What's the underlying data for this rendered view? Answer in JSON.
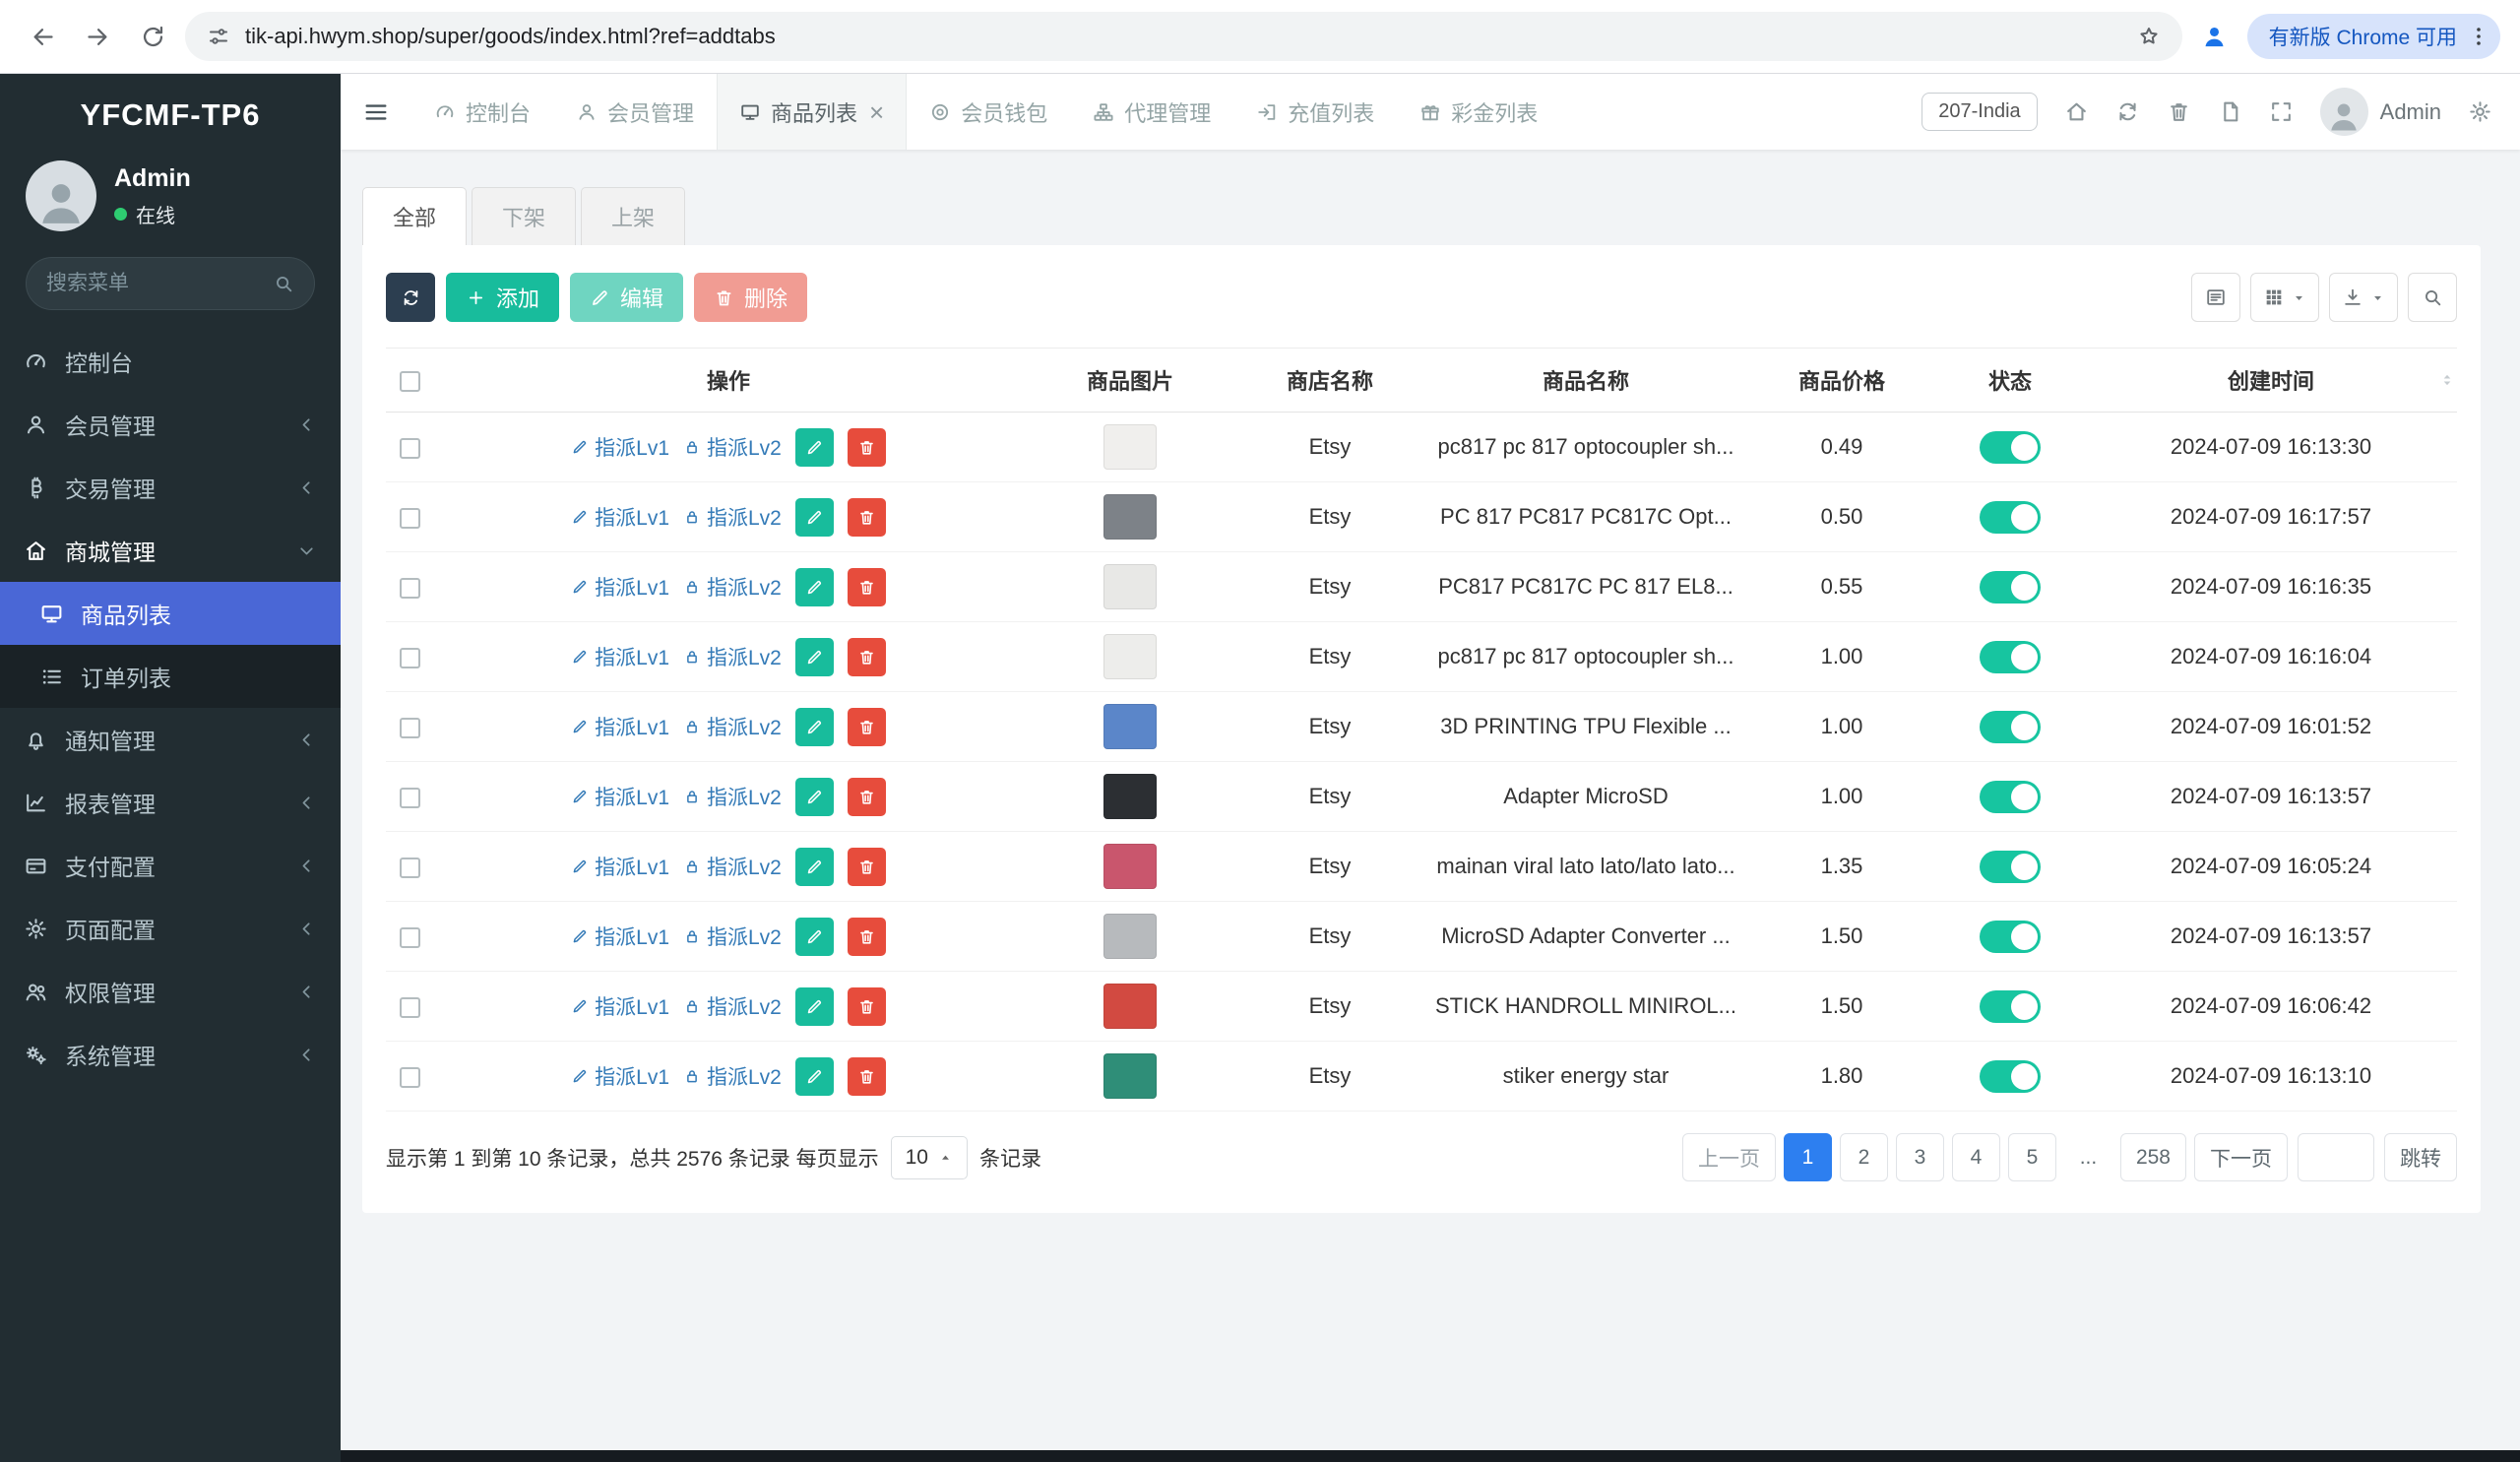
{
  "browser": {
    "url": "tik-api.hwym.shop/super/goods/index.html?ref=addtabs",
    "update_chip": "有新版 Chrome 可用"
  },
  "sidebar": {
    "logo": "YFCMF-TP6",
    "user": {
      "name": "Admin",
      "status": "在线"
    },
    "search_placeholder": "搜索菜单",
    "menu": [
      {
        "label": "控制台",
        "icon": "gauge"
      },
      {
        "label": "会员管理",
        "icon": "user",
        "chevron": "left"
      },
      {
        "label": "交易管理",
        "icon": "bitcoin",
        "chevron": "left"
      },
      {
        "label": "商城管理",
        "icon": "store",
        "chevron": "down",
        "open": true,
        "children": [
          {
            "label": "商品列表",
            "icon": "monitor",
            "active": true
          },
          {
            "label": "订单列表",
            "icon": "list"
          }
        ]
      },
      {
        "label": "通知管理",
        "icon": "bell",
        "chevron": "left"
      },
      {
        "label": "报表管理",
        "icon": "chart",
        "chevron": "left"
      },
      {
        "label": "支付配置",
        "icon": "card",
        "chevron": "left"
      },
      {
        "label": "页面配置",
        "icon": "gear",
        "chevron": "left"
      },
      {
        "label": "权限管理",
        "icon": "users",
        "chevron": "left"
      },
      {
        "label": "系统管理",
        "icon": "cogs",
        "chevron": "left"
      }
    ]
  },
  "topnav": {
    "tabs": [
      {
        "label": "控制台",
        "icon": "gauge"
      },
      {
        "label": "会员管理",
        "icon": "user"
      },
      {
        "label": "商品列表",
        "icon": "monitor",
        "active": true,
        "closable": true
      },
      {
        "label": "会员钱包",
        "icon": "wallet"
      },
      {
        "label": "代理管理",
        "icon": "sitemap"
      },
      {
        "label": "充值列表",
        "icon": "signin"
      },
      {
        "label": "彩金列表",
        "icon": "gift"
      }
    ],
    "region": "207-India",
    "user": "Admin"
  },
  "filter_tabs": [
    {
      "label": "全部",
      "active": true
    },
    {
      "label": "下架"
    },
    {
      "label": "上架"
    }
  ],
  "toolbar": {
    "add": "添加",
    "edit": "编辑",
    "del": "删除"
  },
  "table": {
    "columns": [
      "操作",
      "商品图片",
      "商店名称",
      "商品名称",
      "商品价格",
      "状态",
      "创建时间"
    ],
    "assign_lv1": "指派Lv1",
    "assign_lv2": "指派Lv2",
    "rows": [
      {
        "shop": "Etsy",
        "name": "pc817 pc 817 optocoupler sh...",
        "price": "0.49",
        "created": "2024-07-09 16:13:30",
        "on": true,
        "thumb": "#f0efed"
      },
      {
        "shop": "Etsy",
        "name": "PC 817 PC817 PC817C Opt...",
        "price": "0.50",
        "created": "2024-07-09 16:17:57",
        "on": true,
        "thumb": "#7d8288"
      },
      {
        "shop": "Etsy",
        "name": "PC817 PC817C PC 817 EL8...",
        "price": "0.55",
        "created": "2024-07-09 16:16:35",
        "on": true,
        "thumb": "#e8e8e6"
      },
      {
        "shop": "Etsy",
        "name": "pc817 pc 817 optocoupler sh...",
        "price": "1.00",
        "created": "2024-07-09 16:16:04",
        "on": true,
        "thumb": "#ededeb"
      },
      {
        "shop": "Etsy",
        "name": "3D PRINTING TPU Flexible ...",
        "price": "1.00",
        "created": "2024-07-09 16:01:52",
        "on": true,
        "thumb": "#5b86c9"
      },
      {
        "shop": "Etsy",
        "name": "Adapter MicroSD",
        "price": "1.00",
        "created": "2024-07-09 16:13:57",
        "on": true,
        "thumb": "#2c2f33"
      },
      {
        "shop": "Etsy",
        "name": "mainan viral lato lato/lato lato...",
        "price": "1.35",
        "created": "2024-07-09 16:05:24",
        "on": true,
        "thumb": "#c9566d"
      },
      {
        "shop": "Etsy",
        "name": "MicroSD Adapter Converter ...",
        "price": "1.50",
        "created": "2024-07-09 16:13:57",
        "on": true,
        "thumb": "#b7babd"
      },
      {
        "shop": "Etsy",
        "name": "STICK HANDROLL MINIROL...",
        "price": "1.50",
        "created": "2024-07-09 16:06:42",
        "on": true,
        "thumb": "#d24a41"
      },
      {
        "shop": "Etsy",
        "name": "stiker energy star",
        "price": "1.80",
        "created": "2024-07-09 16:13:10",
        "on": true,
        "thumb": "#2f8e78"
      }
    ]
  },
  "footer": {
    "summary_prefix": "显示第 1 到第 10 条记录，总共 2576 条记录 每页显示",
    "page_size": "10",
    "summary_suffix": "条记录",
    "pages": [
      {
        "label": "上一页",
        "kind": "prev"
      },
      {
        "label": "1",
        "active": true
      },
      {
        "label": "2"
      },
      {
        "label": "3"
      },
      {
        "label": "4"
      },
      {
        "label": "5"
      },
      {
        "label": "...",
        "kind": "ellipsis"
      },
      {
        "label": "258"
      },
      {
        "label": "下一页",
        "kind": "next"
      }
    ],
    "jump": "跳转"
  }
}
